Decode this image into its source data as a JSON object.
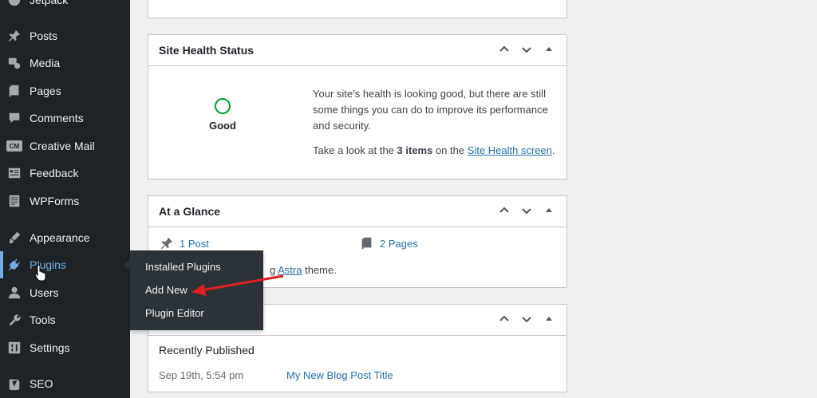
{
  "sidebar": {
    "items": [
      {
        "label": "Jetpack"
      },
      {
        "label": "Posts"
      },
      {
        "label": "Media"
      },
      {
        "label": "Pages"
      },
      {
        "label": "Comments"
      },
      {
        "label": "Creative Mail",
        "badge": "CM"
      },
      {
        "label": "Feedback"
      },
      {
        "label": "WPForms"
      },
      {
        "label": "Appearance"
      },
      {
        "label": "Plugins"
      },
      {
        "label": "Users"
      },
      {
        "label": "Tools"
      },
      {
        "label": "Settings"
      },
      {
        "label": "SEO"
      }
    ],
    "active_color": "#72aee6"
  },
  "flyout": {
    "items": [
      {
        "label": "Installed Plugins"
      },
      {
        "label": "Add New"
      },
      {
        "label": "Plugin Editor"
      }
    ]
  },
  "site_health": {
    "title": "Site Health Status",
    "status": "Good",
    "description": "Your site’s health is looking good, but there are still some things you can do to improve its performance and security.",
    "take_look_prefix": "Take a look at the",
    "items_count": "3 items",
    "take_look_mid": "on the",
    "link": "Site Health screen",
    "suffix": "."
  },
  "at_a_glance": {
    "title": "At a Glance",
    "posts": "1 Post",
    "pages": "2 Pages",
    "theme_prefix": "g",
    "theme_link": "Astra",
    "theme_suffix": "theme."
  },
  "activity": {
    "section": "Recently Published",
    "rows": [
      {
        "date": "Sep 19th, 5:54 pm",
        "title": "My New Blog Post Title"
      }
    ]
  },
  "colors": {
    "arrow": "#e02020",
    "health_ring": "#00a32a"
  }
}
